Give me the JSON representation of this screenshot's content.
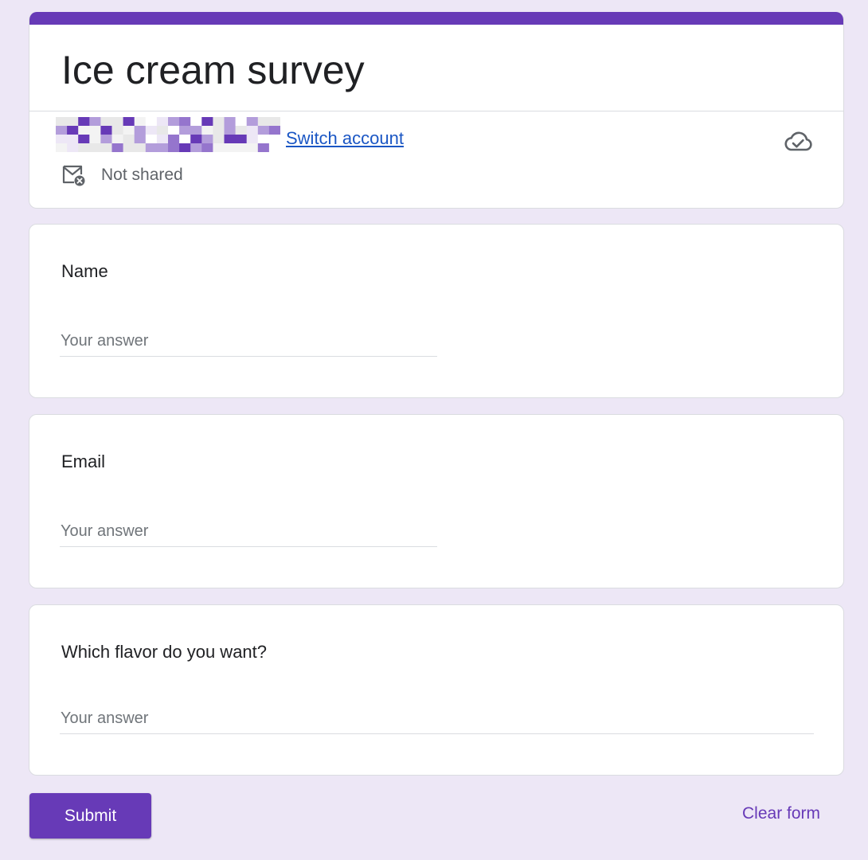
{
  "form": {
    "title": "Ice cream survey",
    "accent_color": "#673ab7",
    "background_color": "#ede7f6"
  },
  "account": {
    "switch_label": "Switch account",
    "sharing_status": "Not shared",
    "cloud_icon": "cloud-done-icon",
    "mail_icon": "mail-not-shared-icon"
  },
  "questions": [
    {
      "label": "Name",
      "placeholder": "Your answer"
    },
    {
      "label": "Email",
      "placeholder": "Your answer"
    },
    {
      "label": "Which flavor do you want?",
      "placeholder": "Your answer"
    }
  ],
  "actions": {
    "submit_label": "Submit",
    "clear_label": "Clear form"
  }
}
